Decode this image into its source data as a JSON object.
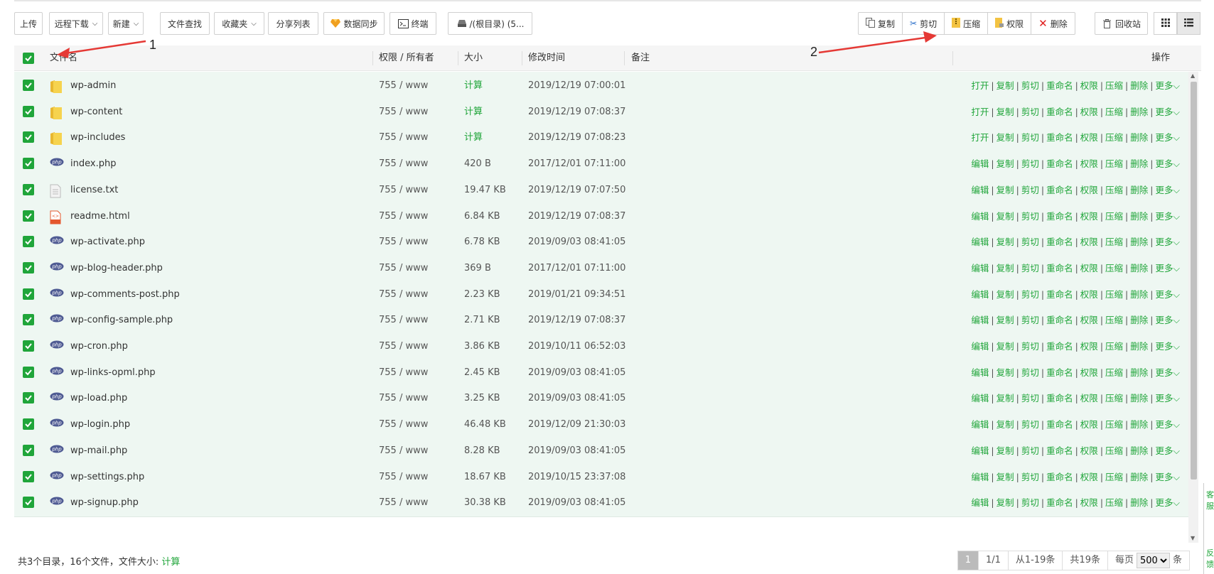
{
  "toolbar": {
    "upload": "上传",
    "remote_download": "远程下载",
    "new": "新建",
    "file_search": "文件查找",
    "favorites": "收藏夹",
    "share_list": "分享列表",
    "data_sync": "数据同步",
    "terminal": "终端",
    "path": "/(根目录) (5...",
    "copy": "复制",
    "cut": "剪切",
    "compress": "压缩",
    "permission": "权限",
    "delete": "删除",
    "recycle_bin": "回收站"
  },
  "table": {
    "headers": {
      "name": "文件名",
      "perm": "权限 / 所有者",
      "size": "大小",
      "mtime": "修改时间",
      "note": "备注",
      "ops": "操作"
    },
    "dir_ops": [
      "打开",
      "复制",
      "剪切",
      "重命名",
      "权限",
      "压缩",
      "删除",
      "更多"
    ],
    "file_ops": [
      "编辑",
      "复制",
      "剪切",
      "重命名",
      "权限",
      "压缩",
      "删除",
      "更多"
    ],
    "rows": [
      {
        "name": "wp-admin",
        "type": "folder",
        "perm": "755 / www",
        "size": "计算",
        "mtime": "2019/12/19 07:00:01"
      },
      {
        "name": "wp-content",
        "type": "folder",
        "perm": "755 / www",
        "size": "计算",
        "mtime": "2019/12/19 07:08:37"
      },
      {
        "name": "wp-includes",
        "type": "folder",
        "perm": "755 / www",
        "size": "计算",
        "mtime": "2019/12/19 07:08:23"
      },
      {
        "name": "index.php",
        "type": "php",
        "perm": "755 / www",
        "size": "420 B",
        "mtime": "2017/12/01 07:11:00"
      },
      {
        "name": "license.txt",
        "type": "txt",
        "perm": "755 / www",
        "size": "19.47 KB",
        "mtime": "2019/12/19 07:07:50"
      },
      {
        "name": "readme.html",
        "type": "html",
        "perm": "755 / www",
        "size": "6.84 KB",
        "mtime": "2019/12/19 07:08:37"
      },
      {
        "name": "wp-activate.php",
        "type": "php",
        "perm": "755 / www",
        "size": "6.78 KB",
        "mtime": "2019/09/03 08:41:05"
      },
      {
        "name": "wp-blog-header.php",
        "type": "php",
        "perm": "755 / www",
        "size": "369 B",
        "mtime": "2017/12/01 07:11:00"
      },
      {
        "name": "wp-comments-post.php",
        "type": "php",
        "perm": "755 / www",
        "size": "2.23 KB",
        "mtime": "2019/01/21 09:34:51"
      },
      {
        "name": "wp-config-sample.php",
        "type": "php",
        "perm": "755 / www",
        "size": "2.71 KB",
        "mtime": "2019/12/19 07:08:37"
      },
      {
        "name": "wp-cron.php",
        "type": "php",
        "perm": "755 / www",
        "size": "3.86 KB",
        "mtime": "2019/10/11 06:52:03"
      },
      {
        "name": "wp-links-opml.php",
        "type": "php",
        "perm": "755 / www",
        "size": "2.45 KB",
        "mtime": "2019/09/03 08:41:05"
      },
      {
        "name": "wp-load.php",
        "type": "php",
        "perm": "755 / www",
        "size": "3.25 KB",
        "mtime": "2019/09/03 08:41:05"
      },
      {
        "name": "wp-login.php",
        "type": "php",
        "perm": "755 / www",
        "size": "46.48 KB",
        "mtime": "2019/12/09 21:30:03"
      },
      {
        "name": "wp-mail.php",
        "type": "php",
        "perm": "755 / www",
        "size": "8.28 KB",
        "mtime": "2019/09/03 08:41:05"
      },
      {
        "name": "wp-settings.php",
        "type": "php",
        "perm": "755 / www",
        "size": "18.67 KB",
        "mtime": "2019/10/15 23:37:08"
      },
      {
        "name": "wp-signup.php",
        "type": "php",
        "perm": "755 / www",
        "size": "30.38 KB",
        "mtime": "2019/09/03 08:41:05"
      }
    ]
  },
  "footer": {
    "summary": "共3个目录，16个文件，文件大小:",
    "calc": "计算",
    "page_current": "1",
    "page_total": "1/1",
    "range": "从1-19条",
    "total": "共19条",
    "per_page_label": "每页",
    "per_page_value": "500",
    "unit": "条"
  },
  "annotations": {
    "label1": "1",
    "label2": "2"
  },
  "side_widget": {
    "top_text": "客服",
    "bottom_text": "反馈"
  },
  "colors": {
    "accent": "#20a53a",
    "row_bg": "#eef7f2",
    "arrow": "#e53935"
  }
}
